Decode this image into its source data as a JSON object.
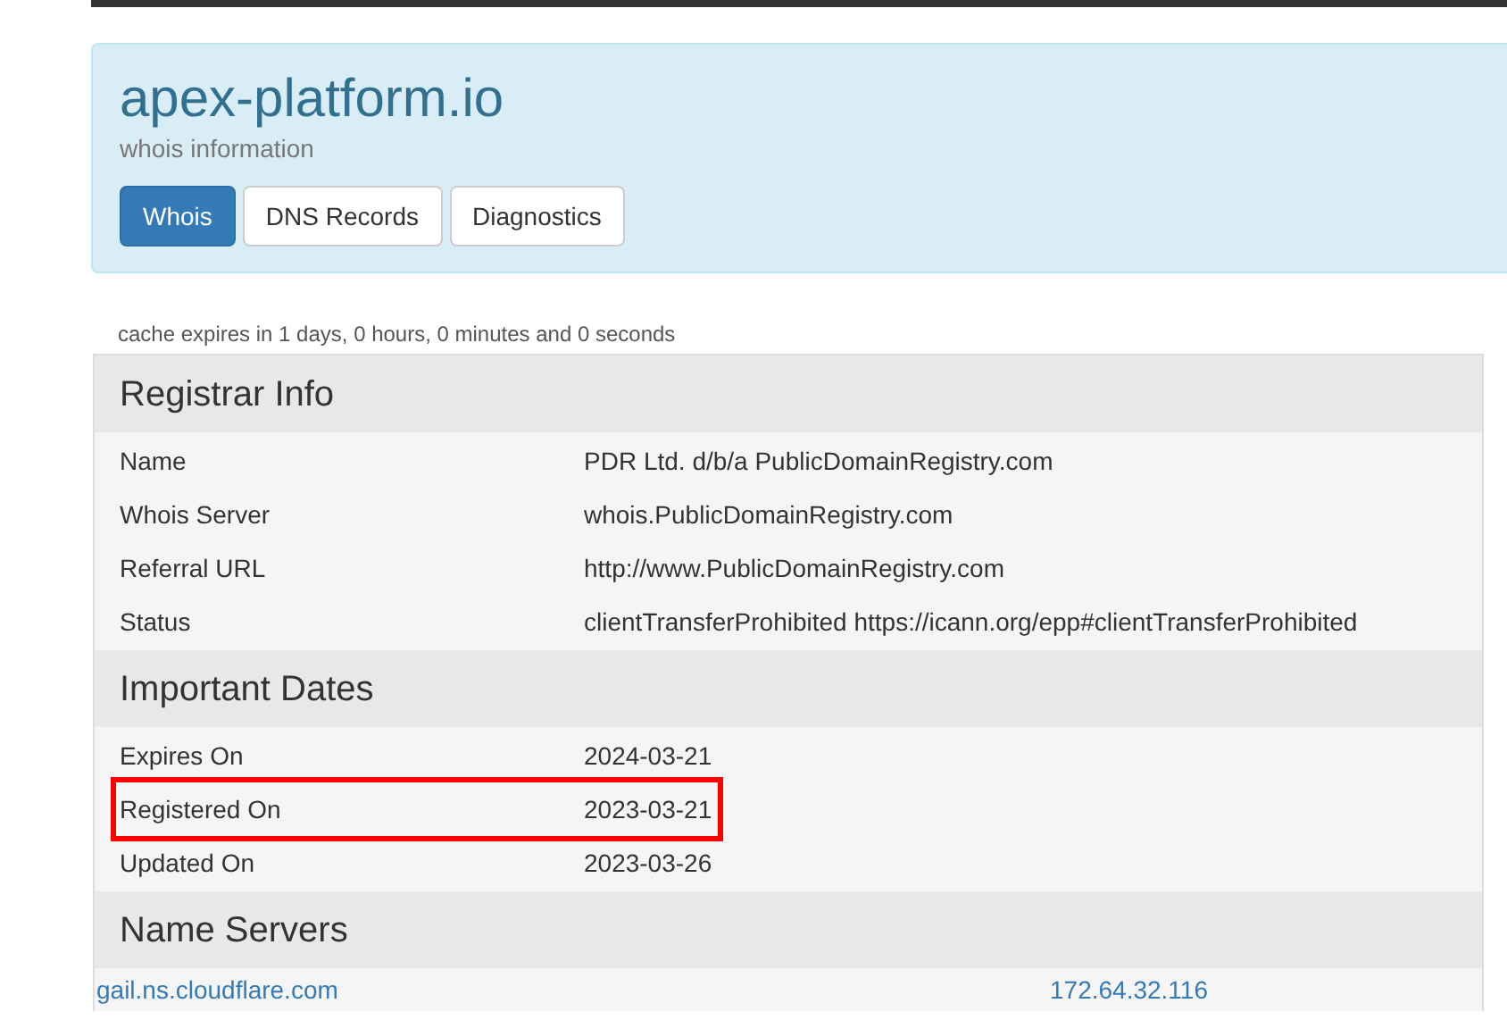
{
  "header": {
    "title": "apex-platform.io",
    "subtitle": "whois information"
  },
  "tabs": [
    {
      "label": "Whois",
      "selected": true
    },
    {
      "label": "DNS Records",
      "selected": false
    },
    {
      "label": "Diagnostics",
      "selected": false
    }
  ],
  "cache_note": "cache expires in 1 days, 0 hours, 0 minutes and 0 seconds",
  "sections": [
    {
      "title": "Registrar Info",
      "rows": [
        {
          "kind": "field",
          "label": "Name",
          "value": "PDR Ltd. d/b/a PublicDomainRegistry.com",
          "highlighted": false
        },
        {
          "kind": "field",
          "label": "Whois Server",
          "value": "whois.PublicDomainRegistry.com",
          "highlighted": false
        },
        {
          "kind": "field",
          "label": "Referral URL",
          "value": "http://www.PublicDomainRegistry.com",
          "highlighted": false
        },
        {
          "kind": "field",
          "label": "Status",
          "value": "clientTransferProhibited https://icann.org/epp#clientTransferProhibited",
          "highlighted": false
        }
      ]
    },
    {
      "title": "Important Dates",
      "rows": [
        {
          "kind": "field",
          "label": "Expires On",
          "value": "2024-03-21",
          "highlighted": false
        },
        {
          "kind": "field",
          "label": "Registered On",
          "value": "2023-03-21",
          "highlighted": true
        },
        {
          "kind": "field",
          "label": "Updated On",
          "value": "2023-03-26",
          "highlighted": false
        }
      ]
    },
    {
      "title": "Name Servers",
      "rows": [
        {
          "kind": "server",
          "label": "gail.ns.cloudflare.com",
          "value": "172.64.32.116"
        }
      ]
    }
  ]
}
